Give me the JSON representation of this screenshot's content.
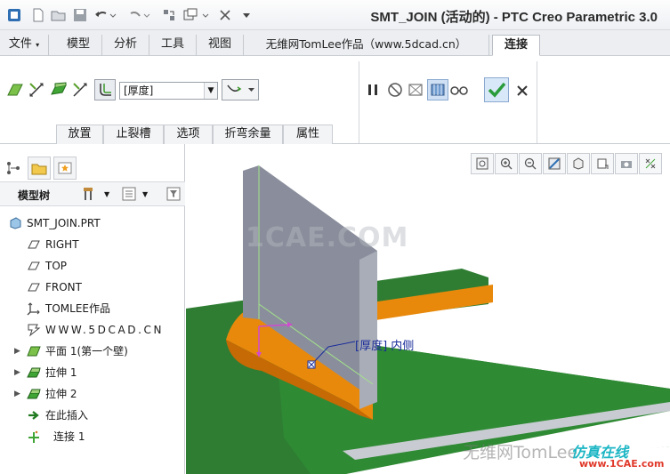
{
  "window": {
    "title": "SMT_JOIN (活动的) - PTC Creo Parametric 3.0"
  },
  "quick_access": {
    "icons": [
      "app-icon",
      "new-icon",
      "open-icon",
      "save-icon",
      "undo-icon",
      "redo-icon",
      "regenerate-icon",
      "windows-icon",
      "close-window-icon",
      "customize-icon"
    ]
  },
  "tabs": [
    {
      "label": "文件",
      "has_dropdown": true
    },
    {
      "label": "模型"
    },
    {
      "label": "分析"
    },
    {
      "label": "工具"
    },
    {
      "label": "视图"
    },
    {
      "label": "无维网TomLee作品（www.5dcad.cn）"
    },
    {
      "label": "连接",
      "active": true
    }
  ],
  "ribbon": {
    "thickness_select": {
      "value": "[厚度]"
    },
    "subtabs": [
      "放置",
      "止裂槽",
      "选项",
      "折弯余量",
      "属性"
    ],
    "confirm_icon": "checkmark-icon",
    "cancel_icon": "x-icon"
  },
  "left_panel": {
    "title": "模型树",
    "tree": [
      {
        "label": "SMT_JOIN.PRT",
        "icon": "part-icon",
        "expandable": false
      },
      {
        "label": "RIGHT",
        "icon": "datum-plane-icon"
      },
      {
        "label": "TOP",
        "icon": "datum-plane-icon"
      },
      {
        "label": "FRONT",
        "icon": "datum-plane-icon"
      },
      {
        "label": "TOMLEE作品",
        "icon": "coordinate-system-icon"
      },
      {
        "label": "WWW.5DCAD.CN",
        "icon": "csys-label-icon"
      },
      {
        "label": "平面 1(第一个壁)",
        "icon": "sheetmetal-wall-icon",
        "expandable": true
      },
      {
        "label": "拉伸 1",
        "icon": "extrude-icon",
        "expandable": true
      },
      {
        "label": "拉伸 2",
        "icon": "extrude-icon",
        "expandable": true
      },
      {
        "label": "在此插入",
        "icon": "insert-here-icon"
      },
      {
        "label": "连接 1",
        "icon": "join-icon"
      }
    ]
  },
  "viewport": {
    "watermark": "1CAE.COM",
    "dimension_label": "[厚度] 内侧",
    "footer_watermark": "无维网TomLee",
    "footer_brand": "仿真在线",
    "footer_url": "www.1CAE.com"
  },
  "colors": {
    "accent_tab": "#ffffff",
    "wall_grey": "#8a8e9a",
    "sheet_green": "#2b7a2e",
    "join_orange": "#e8890c",
    "confirm_green": "#2a9c3a"
  }
}
